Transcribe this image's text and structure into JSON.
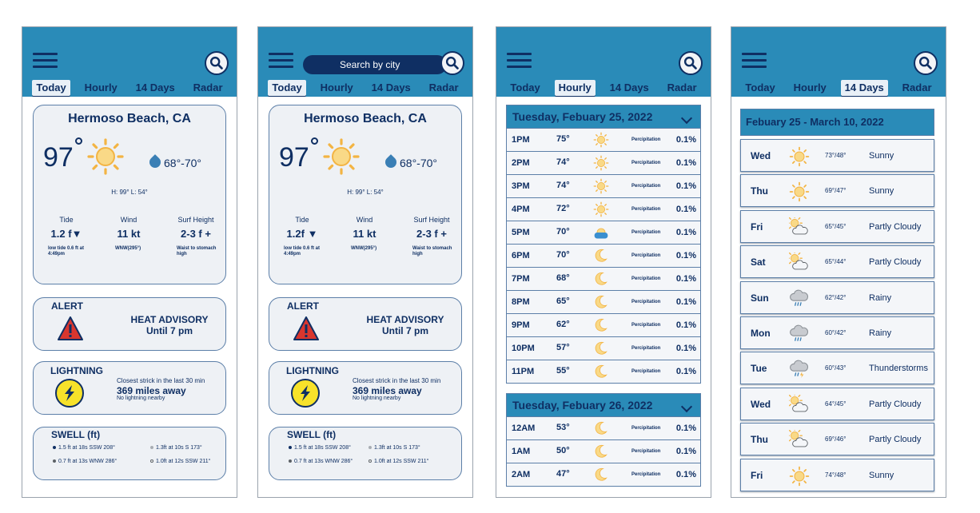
{
  "tabs": [
    "Today",
    "Hourly",
    "14 Days",
    "Radar"
  ],
  "search": {
    "placeholder": "Search by city"
  },
  "today": {
    "city": "Hermoso Beach, CA",
    "temp": "97",
    "range": "68°-70°",
    "hilo": "H: 99° L: 54°",
    "tide": {
      "label": "Tide",
      "value": "1.2 f",
      "value_alt": "1.2f",
      "note": "low tide 0.6 ft at 4:49pm"
    },
    "wind": {
      "label": "Wind",
      "value": "11 kt",
      "note": "WNW(295°)"
    },
    "surf": {
      "label": "Surf Height",
      "value": "2-3 f +",
      "note": "Waist to stomach high"
    }
  },
  "alert": {
    "label": "ALERT",
    "title": "HEAT ADVISORY",
    "until": "Until 7 pm"
  },
  "lightning": {
    "label": "LIGHTNING",
    "line1": "Closest strick in the last 30 min",
    "distance": "369 miles away",
    "line3": "No lightning nearby"
  },
  "swell": {
    "label": "SWELL (ft)",
    "items": [
      {
        "text": "1.5 ft at 18s SSW 208°",
        "color": "#0f2f63"
      },
      {
        "text": "1.3ft at 10s S 173°",
        "color": "#a8adb3"
      },
      {
        "text": "0.7 ft at 13s WNW 286°",
        "color": "#5c6166"
      },
      {
        "text": "1.0ft at 12s SSW 211°",
        "color": "#ffffff"
      }
    ]
  },
  "hourly": {
    "precip_label": "Percipitation",
    "days": [
      {
        "title": "Tuesday, Febuary 25, 2022",
        "rows": [
          {
            "hour": "1PM",
            "temp": "75°",
            "icon": "sun-icon",
            "precip": "0.1%"
          },
          {
            "hour": "2PM",
            "temp": "74°",
            "icon": "sun-icon",
            "precip": "0.1%"
          },
          {
            "hour": "3PM",
            "temp": "74°",
            "icon": "sun-icon",
            "precip": "0.1%"
          },
          {
            "hour": "4PM",
            "temp": "72°",
            "icon": "sun-icon",
            "precip": "0.1%"
          },
          {
            "hour": "5PM",
            "temp": "70°",
            "icon": "sunset-icon",
            "precip": "0.1%"
          },
          {
            "hour": "6PM",
            "temp": "70°",
            "icon": "moon-icon",
            "precip": "0.1%"
          },
          {
            "hour": "7PM",
            "temp": "68°",
            "icon": "moon-icon",
            "precip": "0.1%"
          },
          {
            "hour": "8PM",
            "temp": "65°",
            "icon": "moon-icon",
            "precip": "0.1%"
          },
          {
            "hour": "9PM",
            "temp": "62°",
            "icon": "moon-icon",
            "precip": "0.1%"
          },
          {
            "hour": "10PM",
            "temp": "57°",
            "icon": "moon-icon",
            "precip": "0.1%"
          },
          {
            "hour": "11PM",
            "temp": "55°",
            "icon": "moon-icon",
            "precip": "0.1%"
          }
        ]
      },
      {
        "title": "Tuesday, Febuary 26, 2022",
        "rows": [
          {
            "hour": "12AM",
            "temp": "53°",
            "icon": "moon-icon",
            "precip": "0.1%"
          },
          {
            "hour": "1AM",
            "temp": "50°",
            "icon": "moon-icon",
            "precip": "0.1%"
          },
          {
            "hour": "2AM",
            "temp": "47°",
            "icon": "moon-icon",
            "precip": "0.1%"
          }
        ]
      }
    ]
  },
  "forecast": {
    "range": "Febuary 25 - March 10, 2022",
    "days": [
      {
        "day": "Wed",
        "temps": "73°/48°",
        "cond": "Sunny",
        "icon": "sun-icon"
      },
      {
        "day": "Thu",
        "temps": "69°/47°",
        "cond": "Sunny",
        "icon": "sun-icon"
      },
      {
        "day": "Fri",
        "temps": "65°/45°",
        "cond": "Partly Cloudy",
        "icon": "partly-cloudy-icon"
      },
      {
        "day": "Sat",
        "temps": "65°/44°",
        "cond": "Partly Cloudy",
        "icon": "partly-cloudy-icon"
      },
      {
        "day": "Sun",
        "temps": "62°/42°",
        "cond": "Rainy",
        "icon": "rain-icon"
      },
      {
        "day": "Mon",
        "temps": "60°/42°",
        "cond": "Rainy",
        "icon": "rain-icon"
      },
      {
        "day": "Tue",
        "temps": "60°/43°",
        "cond": "Thunderstorms",
        "icon": "thunderstorm-icon"
      },
      {
        "day": "Wed",
        "temps": "64°/45°",
        "cond": "Partly Cloudy",
        "icon": "partly-cloudy-icon"
      },
      {
        "day": "Thu",
        "temps": "69°/46°",
        "cond": "Partly Cloudy",
        "icon": "partly-cloudy-icon"
      },
      {
        "day": "Fri",
        "temps": "74°/48°",
        "cond": "Sunny",
        "icon": "sun-icon"
      }
    ]
  }
}
